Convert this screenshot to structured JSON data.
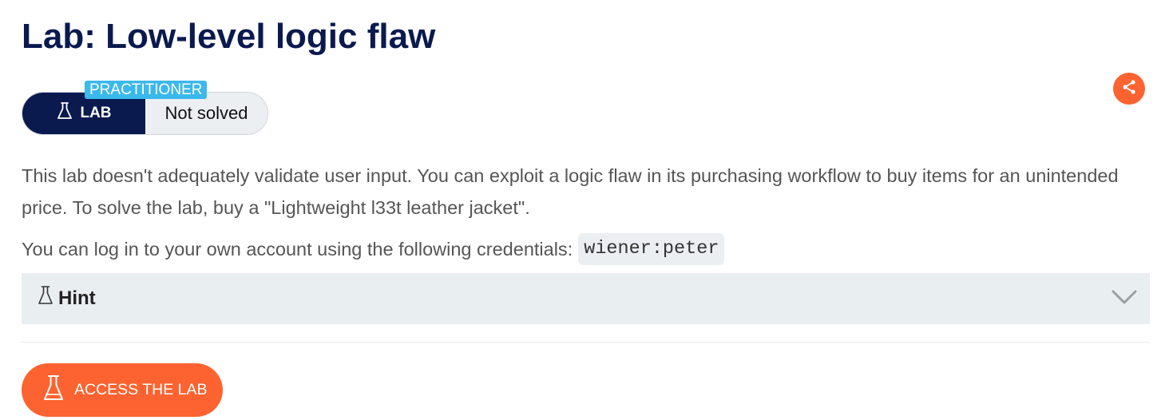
{
  "page": {
    "title": "Lab: Low-level logic flaw"
  },
  "badge": {
    "level": "PRACTITIONER",
    "type_label": "LAB",
    "status": "Not solved"
  },
  "description": {
    "paragraph1": "This lab doesn't adequately validate user input. You can exploit a logic flaw in its purchasing workflow to buy items for an unintended price. To solve the lab, buy a \"Lightweight l33t leather jacket\".",
    "paragraph2_text": "You can log in to your own account using the following credentials:",
    "credentials": "wiener:peter"
  },
  "hint": {
    "label": "Hint"
  },
  "access": {
    "label": "ACCESS THE LAB"
  },
  "icons": {
    "lab": "flask-icon",
    "share": "share-icon",
    "chevron": "chevron-down-icon"
  },
  "colors": {
    "navy": "#0a1a4f",
    "orange": "#fd6330",
    "level_blue": "#3bb8ec",
    "panel_gray": "#ebeff2"
  }
}
